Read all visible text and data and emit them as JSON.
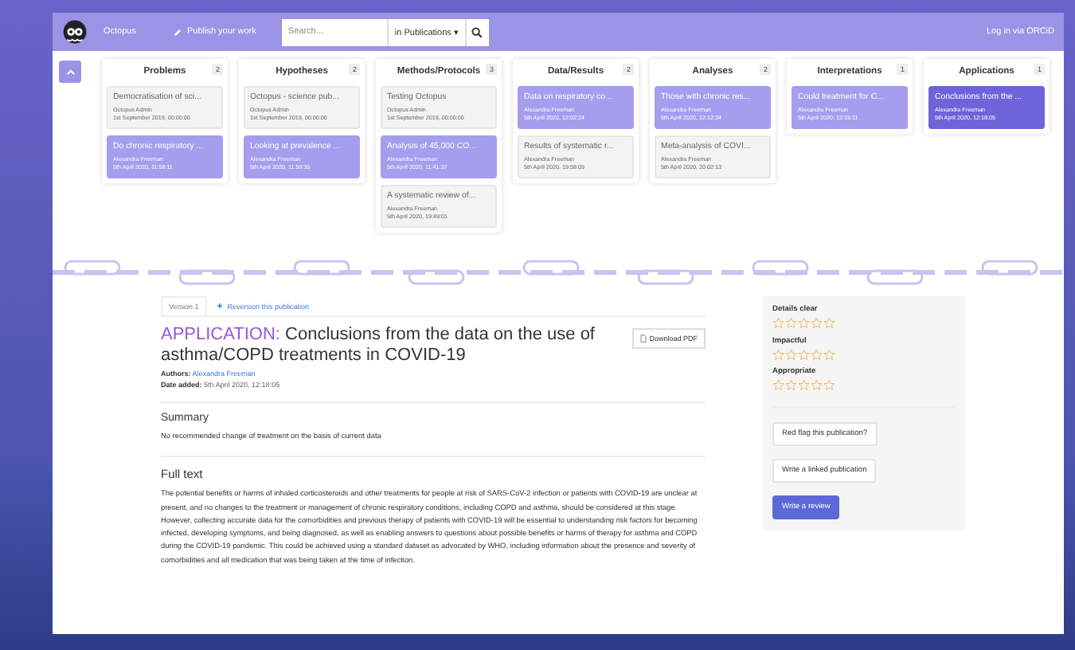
{
  "nav": {
    "logo_text": "Octopus",
    "publish": "Publish your work",
    "search": {
      "placeholder": "Search...",
      "scope": "in Publications",
      "scope_caret": "▾"
    },
    "login": "Log in via ORCiD"
  },
  "stages": [
    {
      "title": "Problems",
      "count": "2",
      "cards": [
        {
          "title": "Democratisation of sci...",
          "author": "Octopus Admin",
          "date": "1st September 2019, 00:00:00",
          "linked": false,
          "selected": false
        },
        {
          "title": "Do chronic respiratory ...",
          "author": "Alexandra Freeman",
          "date": "5th April 2020, 11:58:11",
          "linked": true,
          "selected": false
        }
      ]
    },
    {
      "title": "Hypotheses",
      "count": "2",
      "cards": [
        {
          "title": "Octopus - science pub...",
          "author": "Octopus Admin",
          "date": "1st September 2019, 00:00:00",
          "linked": false,
          "selected": false
        },
        {
          "title": "Looking at prevalence ...",
          "author": "Alexandra Freeman",
          "date": "5th April 2020, 11:59:35",
          "linked": true,
          "selected": false
        }
      ]
    },
    {
      "title": "Methods/Protocols",
      "count": "3",
      "cards": [
        {
          "title": "Testing Octopus",
          "author": "Octopus Admin",
          "date": "1st September 2019, 00:00:00",
          "linked": false,
          "selected": false
        },
        {
          "title": "Analysis of 45,000 CO...",
          "author": "Alexandra Freeman",
          "date": "5th April 2020, 11:41:37",
          "linked": true,
          "selected": false
        },
        {
          "title": "A systematic review of...",
          "author": "Alexandra Freeman",
          "date": "5th April 2020, 19:49:01",
          "linked": false,
          "selected": false
        }
      ]
    },
    {
      "title": "Data/Results",
      "count": "2",
      "cards": [
        {
          "title": "Data on respiratory co...",
          "author": "Alexandra Freeman",
          "date": "5th April 2020, 12:02:24",
          "linked": true,
          "selected": false
        },
        {
          "title": "Results of systematic r...",
          "author": "Alexandra Freeman",
          "date": "5th April 2020, 19:58:09",
          "linked": false,
          "selected": false
        }
      ]
    },
    {
      "title": "Analyses",
      "count": "2",
      "cards": [
        {
          "title": "Those with chronic res...",
          "author": "Alexandra Freeman",
          "date": "5th April 2020, 12:12:34",
          "linked": true,
          "selected": false
        },
        {
          "title": "Meta-analysis of COVI...",
          "author": "Alexandra Freeman",
          "date": "5th April 2020, 20:02:13",
          "linked": false,
          "selected": false
        }
      ]
    },
    {
      "title": "Interpretations",
      "count": "1",
      "cards": [
        {
          "title": "Could treatment for C...",
          "author": "Alexandra Freeman",
          "date": "5th April 2020, 12:15:11",
          "linked": true,
          "selected": false
        }
      ]
    },
    {
      "title": "Applications",
      "count": "1",
      "cards": [
        {
          "title": "Conclusions from the ...",
          "author": "Alexandra Freeman",
          "date": "5th April 2020, 12:18:05",
          "linked": true,
          "selected": true
        }
      ]
    }
  ],
  "publication": {
    "version_tab": "Version 1",
    "revision_link": "Reversion this publication",
    "type_label": "APPLICATION:",
    "title": "Conclusions from the data on the use of asthma/COPD treatments in COVID-19",
    "download": "Download PDF",
    "authors_label": "Authors:",
    "authors": "Alexandra Freeman",
    "date_label": "Date added:",
    "date": "5th April 2020, 12:18:05",
    "summary_heading": "Summary",
    "summary": "No recommended change of treatment on the basis of current data",
    "full_text_heading": "Full text",
    "full_text": "The potential benefits or harms of inhaled corticosteroids and other treatments for people at risk of SARS-CoV-2 infection or patients with COVID-19 are unclear at present, and no changes to the treatment or management of chronic respiratory conditions, including COPD and asthma, should be considered at this stage. However, collecting accurate data for the comorbidities and previous therapy of patients with COVID-19 will be essential to understanding risk factors for becoming infected, developing symptoms, and being diagnosed, as well as enabling answers to questions about possible benefits or harms of therapy for asthma and COPD during the COVID-19 pandemic. This could be achieved using a standard dataset as advocated by WHO, including information about the presence and severity of comorbidities and all medication that was being taken at the time of infection."
  },
  "ratings": [
    {
      "label": "Details clear",
      "stars": 0
    },
    {
      "label": "Impactful",
      "stars": 0
    },
    {
      "label": "Appropriate",
      "stars": 0
    }
  ],
  "actions": [
    {
      "label": "Red flag this publication?",
      "kind": "secondary"
    },
    {
      "label": "Write a linked publication",
      "kind": "secondary"
    },
    {
      "label": "Write a review",
      "kind": "primary"
    }
  ]
}
